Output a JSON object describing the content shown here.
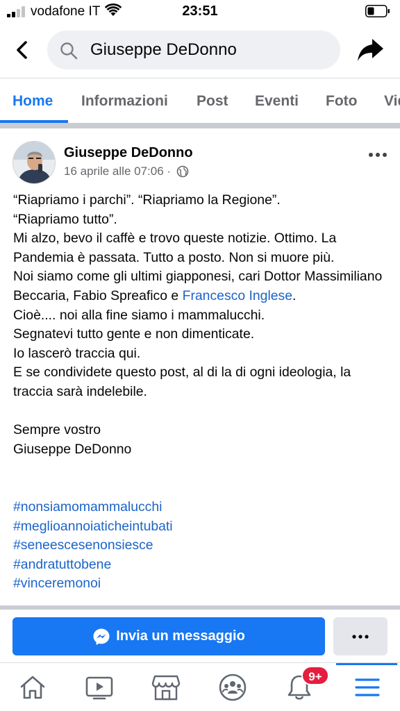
{
  "status_bar": {
    "carrier": "vodafone IT",
    "time": "23:51"
  },
  "search": {
    "query": "Giuseppe DeDonno"
  },
  "tabs": [
    {
      "label": "Home",
      "active": true
    },
    {
      "label": "Informazioni",
      "active": false
    },
    {
      "label": "Post",
      "active": false
    },
    {
      "label": "Eventi",
      "active": false
    },
    {
      "label": "Foto",
      "active": false
    },
    {
      "label": "Vid",
      "active": false
    }
  ],
  "post": {
    "author": "Giuseppe DeDonno",
    "date": "16 aprile alle 07:06 ·",
    "body_before_mention": "“Riapriamo i parchi”. “Riapriamo la Regione”.\n“Riapriamo tutto”.\nMi alzo, bevo il caffè e trovo queste notizie. Ottimo. La Pandemia è passata. Tutto a posto. Non si muore più.\nNoi siamo come gli ultimi giapponesi, cari Dottor Massimiliano Beccaria, Fabio Spreafico e ",
    "mention": "Francesco Inglese",
    "body_after_mention": ".\nCioè.... noi alla fine siamo i mammalucchi.\nSegnatevi tutto gente e non dimenticate.\nIo lascerò traccia qui.\nE se condividete questo post, al di la di ogni ideologia, la traccia sarà indelebile.\n\nSempre vostro\nGiuseppe DeDonno",
    "hashtags": [
      "#nonsiamomammalucchi",
      "#meglioannoiaticheintubati",
      "#seneescesenonsiesce",
      "#andratuttobene",
      "#vinceremonoi"
    ]
  },
  "actions": {
    "message_label": "Invia un messaggio"
  },
  "bottom_nav": {
    "notifications_badge": "9+"
  },
  "colors": {
    "accent": "#1877f2",
    "badge": "#e41e3f",
    "link": "#1b64c8"
  }
}
